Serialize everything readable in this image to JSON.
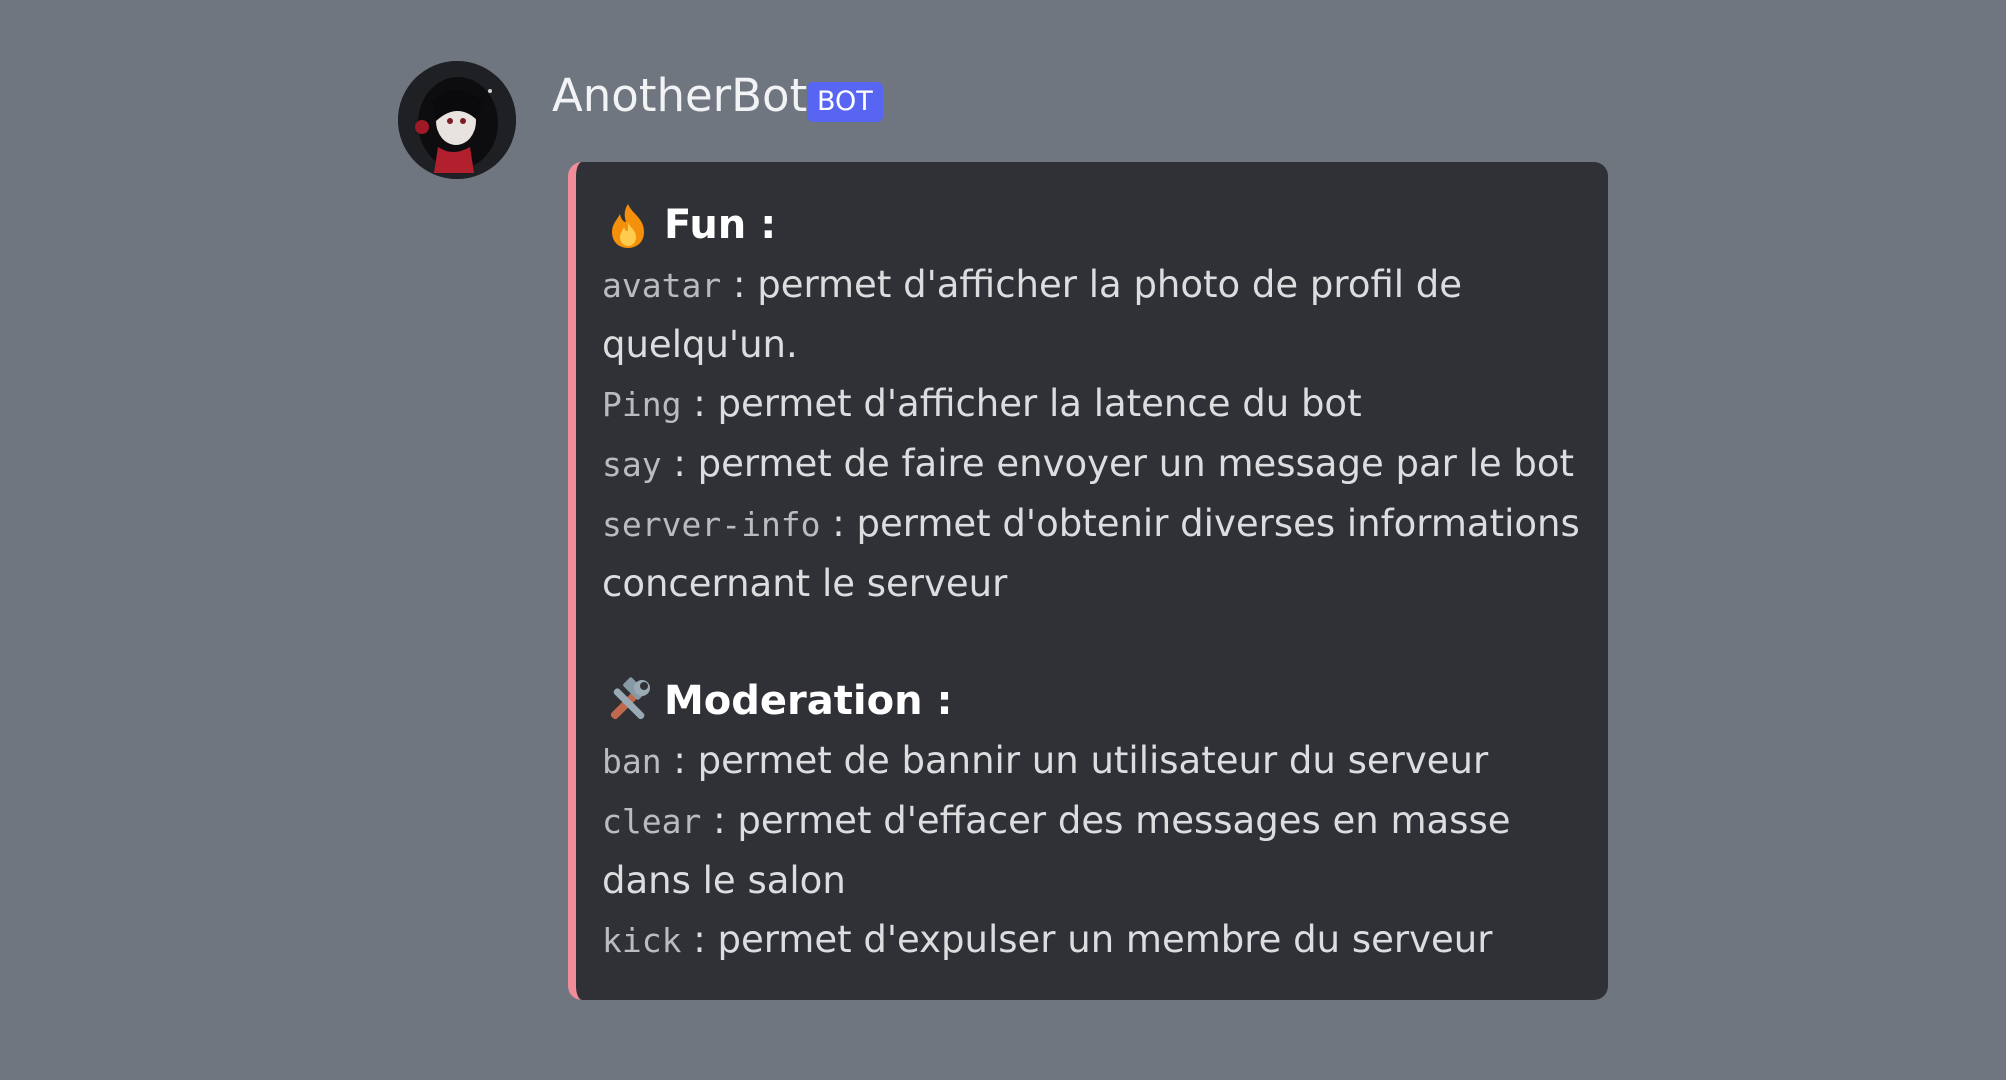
{
  "message": {
    "username": "AnotherBot",
    "bot_tag": "BOT",
    "avatar_icon": "anime-avatar-icon",
    "embed_color": "#f08d99"
  },
  "embed": {
    "sections": [
      {
        "emoji": "fire-emoji",
        "title": "Fun :",
        "commands": [
          {
            "cmd": "avatar",
            "desc": " : permet d'afficher la photo de profil de quelqu'un."
          },
          {
            "cmd": "Ping",
            "desc": " : permet d'afficher la latence du bot"
          },
          {
            "cmd": "say",
            "desc": " : permet de faire envoyer un message par le bot"
          },
          {
            "cmd": "server-info",
            "desc": " : permet d'obtenir diverses informations concernant le serveur"
          }
        ]
      },
      {
        "emoji": "hammer-and-wrench-emoji",
        "title": "Moderation :",
        "commands": [
          {
            "cmd": "ban",
            "desc": " : permet de bannir un utilisateur du serveur"
          },
          {
            "cmd": "clear",
            "desc": " : permet d'effacer des messages en masse dans le salon"
          },
          {
            "cmd": "kick",
            "desc": " : permet d'expulser un membre du serveur"
          }
        ]
      }
    ]
  }
}
